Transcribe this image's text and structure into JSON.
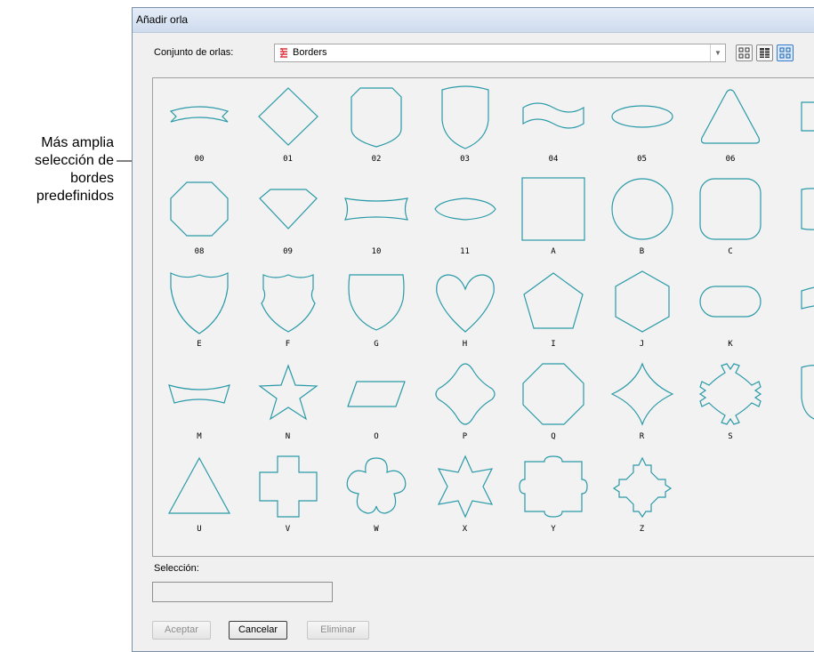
{
  "annotation": {
    "text": "Más amplia selección de bordes predefinidos"
  },
  "dialog": {
    "title": "Añadir orla",
    "set_label": "Conjunto de orlas:",
    "set_value": "Borders",
    "selection_label": "Selección:",
    "selection_value": "",
    "buttons": {
      "accept": "Aceptar",
      "cancel": "Cancelar",
      "delete": "Eliminar"
    },
    "view_buttons": [
      "small-icons-view-icon",
      "list-view-icon",
      "large-icons-view-icon"
    ],
    "shape_color": "#2a9aa8"
  },
  "borders": [
    "00",
    "01",
    "02",
    "03",
    "04",
    "05",
    "06",
    "",
    "08",
    "09",
    "10",
    "11",
    "A",
    "B",
    "C",
    "",
    "E",
    "F",
    "G",
    "H",
    "I",
    "J",
    "K",
    "",
    "M",
    "N",
    "O",
    "P",
    "Q",
    "R",
    "S",
    "",
    "U",
    "V",
    "W",
    "X",
    "Y",
    "Z"
  ]
}
